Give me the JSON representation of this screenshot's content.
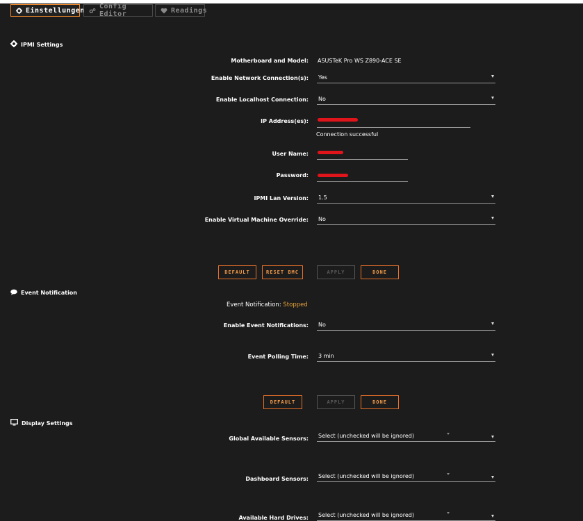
{
  "tabs": [
    {
      "label": "Einstellungen"
    },
    {
      "label": "Config Editor"
    },
    {
      "label": "Readings"
    }
  ],
  "ipmi": {
    "title": "IPMI Settings",
    "motherboard_label": "Motherboard and Model:",
    "motherboard_value": "ASUSTeK Pro WS Z890-ACE SE",
    "network_label": "Enable Network Connection(s):",
    "network_value": "Yes",
    "localhost_label": "Enable Localhost Connection:",
    "localhost_value": "No",
    "ip_label": "IP Address(es):",
    "connection_status": "Connection successful",
    "user_label": "User Name:",
    "password_label": "Password:",
    "lan_label": "IPMI Lan Version:",
    "lan_value": "1.5",
    "vm_label": "Enable Virtual Machine Override:",
    "vm_value": "No",
    "buttons": {
      "default": "DEFAULT",
      "reset_bmc": "RESET BMC",
      "apply": "APPLY",
      "done": "DONE"
    }
  },
  "event": {
    "title": "Event Notification",
    "status_label": "Event Notification:",
    "status_value": "Stopped",
    "enable_label": "Enable Event Notifications:",
    "enable_value": "No",
    "polling_label": "Event Polling Time:",
    "polling_value": "3 min",
    "buttons": {
      "default": "DEFAULT",
      "apply": "APPLY",
      "done": "DONE"
    }
  },
  "display": {
    "title": "Display Settings",
    "global_label": "Global Available Sensors:",
    "global_value": "Select (unchecked will be ignored)",
    "dashboard_label": "Dashboard Sensors:",
    "dashboard_value": "Select (unchecked will be ignored)",
    "drives_label": "Available Hard Drives:",
    "drives_value": "Select (unchecked will be ignored)"
  },
  "colors": {
    "accent": "#e9722a",
    "status": "#e9a33a",
    "redaction": "#e0141b"
  }
}
